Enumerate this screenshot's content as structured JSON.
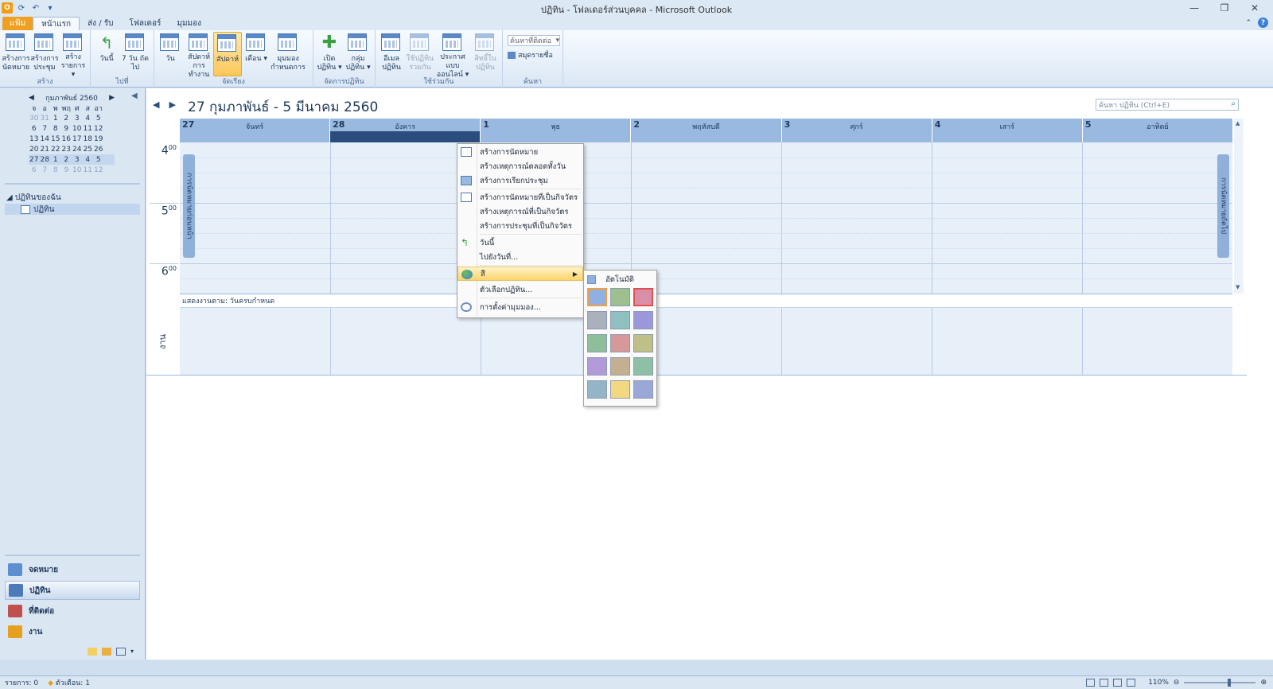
{
  "window": {
    "title": "ปฏิทิน - โฟลเดอร์ส่วนบุคคล - Microsoft Outlook",
    "app_icon_label": "O"
  },
  "tabs": [
    {
      "label": "แฟ้ม"
    },
    {
      "label": "หน้าแรก"
    },
    {
      "label": "ส่ง / รับ"
    },
    {
      "label": "โฟลเดอร์"
    },
    {
      "label": "มุมมอง"
    }
  ],
  "ribbon": {
    "groups": [
      {
        "label": "สร้าง",
        "buttons": [
          {
            "label": "สร้างการ นัดหมาย"
          },
          {
            "label": "สร้างการ ประชุม"
          },
          {
            "label": "สร้าง รายการ ▾"
          }
        ]
      },
      {
        "label": "ไปที่",
        "buttons": [
          {
            "label": "วันนี้"
          },
          {
            "label": "7 วัน ถัดไป"
          }
        ]
      },
      {
        "label": "จัดเรียง",
        "buttons": [
          {
            "label": "วัน"
          },
          {
            "label": "สัปดาห์ การทำงาน"
          },
          {
            "label": "สัปดาห์"
          },
          {
            "label": "เดือน ▾"
          },
          {
            "label": "มุมมอง กำหนดการ"
          }
        ]
      },
      {
        "label": "จัดการปฏิทิน",
        "buttons": [
          {
            "label": "เปิด ปฏิทิน ▾"
          },
          {
            "label": "กลุ่ม ปฏิทิน ▾"
          }
        ]
      },
      {
        "label": "ใช้ร่วมกัน",
        "buttons": [
          {
            "label": "อีเมล ปฏิทิน"
          },
          {
            "label": "ใช้ปฏิทิน ร่วมกัน"
          },
          {
            "label": "ประกาศแบบ ออนไลน์ ▾"
          },
          {
            "label": "สิทธิ์ใน ปฏิทิน"
          }
        ]
      },
      {
        "label": "ค้นหา",
        "combo": "ค้นหาที่ติดต่อ",
        "address_book": "สมุดรายชื่อ"
      }
    ]
  },
  "navigation": {
    "mini_calendar": {
      "month_label": "กุมภาพันธ์ 2560",
      "weekdays": [
        "จ",
        "อ",
        "พ",
        "พฤ",
        "ศ",
        "ส",
        "อา"
      ],
      "weeks": [
        [
          "30",
          "31",
          "1",
          "2",
          "3",
          "4",
          "5"
        ],
        [
          "6",
          "7",
          "8",
          "9",
          "10",
          "11",
          "12"
        ],
        [
          "13",
          "14",
          "15",
          "16",
          "17",
          "18",
          "19"
        ],
        [
          "20",
          "21",
          "22",
          "23",
          "24",
          "25",
          "26"
        ],
        [
          "27",
          "28",
          "1",
          "2",
          "3",
          "4",
          "5"
        ],
        [
          "6",
          "7",
          "8",
          "9",
          "10",
          "11",
          "12"
        ]
      ]
    },
    "my_calendars_label": "◢ ปฏิทินของฉัน",
    "calendar_item": "ปฏิทิน",
    "bottom_items": [
      {
        "label": "จดหมาย",
        "color": "#5b8fd0"
      },
      {
        "label": "ปฏิทิน",
        "color": "#4d7ab8"
      },
      {
        "label": "ที่ติดต่อ",
        "color": "#c0504d"
      },
      {
        "label": "งาน",
        "color": "#e6a020"
      }
    ]
  },
  "calendar": {
    "date_range": "27 กุมภาพันธ์ - 5 มีนาคม 2560",
    "search_placeholder": "ค้นหา ปฏิทิน (Ctrl+E)",
    "days": [
      {
        "num": "27",
        "name": "จันทร์"
      },
      {
        "num": "28",
        "name": "อังคาร"
      },
      {
        "num": "1",
        "name": "พุธ"
      },
      {
        "num": "2",
        "name": "พฤหัสบดี"
      },
      {
        "num": "3",
        "name": "ศุกร์"
      },
      {
        "num": "4",
        "name": "เสาร์"
      },
      {
        "num": "5",
        "name": "อาทิตย์"
      }
    ],
    "times": [
      {
        "hour": "4",
        "min": "00"
      },
      {
        "hour": "5",
        "min": "00"
      },
      {
        "hour": "6",
        "min": "00"
      }
    ],
    "prev_appointment": "การนัดหมายก่อนหน้า",
    "next_appointment": "การนัดหมายถัดไป",
    "tasks_bar": "แสดงงานตาม: วันครบกำหนด",
    "tasks_label": "งาน"
  },
  "context_menu": {
    "items": [
      {
        "label": "สร้างการนัดหมาย"
      },
      {
        "label": "สร้างเหตุการณ์ตลอดทั้งวัน"
      },
      {
        "label": "สร้างการเรียกประชุม"
      },
      {
        "label": "สร้างการนัดหมายที่เป็นกิจวัตร"
      },
      {
        "label": "สร้างเหตุการณ์ที่เป็นกิจวัตร"
      },
      {
        "label": "สร้างการประชุมที่เป็นกิจวัตร"
      },
      {
        "label": "วันนี้"
      },
      {
        "label": "ไปยังวันที่..."
      },
      {
        "label": "สี"
      },
      {
        "label": "ตัวเลือกปฏิทิน..."
      },
      {
        "label": "การตั้งค่ามุมมอง..."
      }
    ]
  },
  "color_menu": {
    "automatic_label": "อัตโนมัติ",
    "swatches": [
      "#8fb0e0",
      "#9ec08e",
      "#d98fa8",
      "#aab0bc",
      "#8fc0c0",
      "#9a98d8",
      "#8ebf9a",
      "#d69898",
      "#bfbf88",
      "#b09ad8",
      "#c4b090",
      "#8ec0a8",
      "#94b4c8",
      "#f2d880",
      "#9aa8d8"
    ]
  },
  "statusbar": {
    "items": "รายการ: 0",
    "reminders": "ตัวเตือน: 1",
    "zoom": "110%"
  }
}
